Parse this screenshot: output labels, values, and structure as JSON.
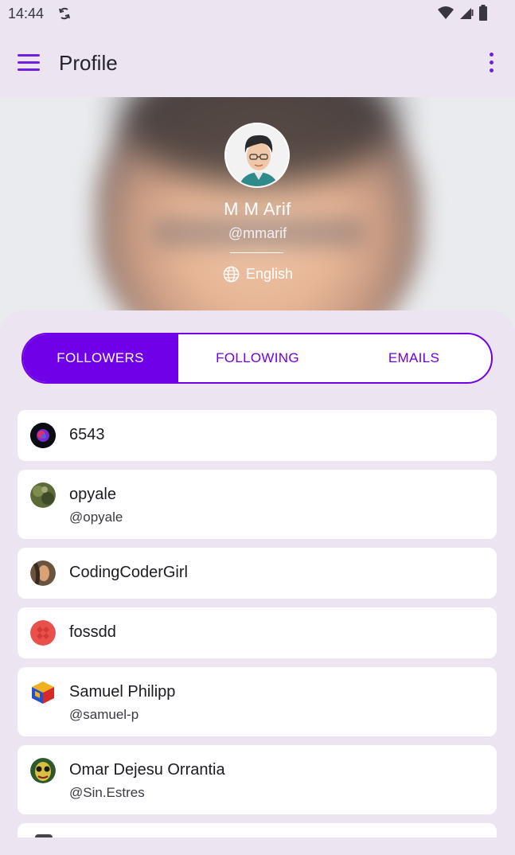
{
  "status_bar": {
    "time": "14:44"
  },
  "app_bar": {
    "title": "Profile"
  },
  "profile": {
    "name": "M M Arif",
    "handle": "@mmarif",
    "language": "English"
  },
  "tabs": [
    {
      "label": "FOLLOWERS",
      "active": true
    },
    {
      "label": "FOLLOWING",
      "active": false
    },
    {
      "label": "EMAILS",
      "active": false
    }
  ],
  "followers": [
    {
      "name": "6543",
      "username": "",
      "avatar": "dark-orb-avatar"
    },
    {
      "name": "opyale",
      "username": "@opyale",
      "avatar": "nature-photo-avatar"
    },
    {
      "name": "CodingCoderGirl",
      "username": "",
      "avatar": "photo-avatar"
    },
    {
      "name": "fossdd",
      "username": "",
      "avatar": "red-identicon-avatar"
    },
    {
      "name": "Samuel Philipp",
      "username": "@samuel-p",
      "avatar": "cube-logo-avatar"
    },
    {
      "name": "Omar Dejesu Orrantia",
      "username": "@Sin.Estres",
      "avatar": "mask-avatar"
    }
  ],
  "colors": {
    "accent": "#6f00e8",
    "background": "#ece5f1",
    "card": "#ffffff"
  }
}
